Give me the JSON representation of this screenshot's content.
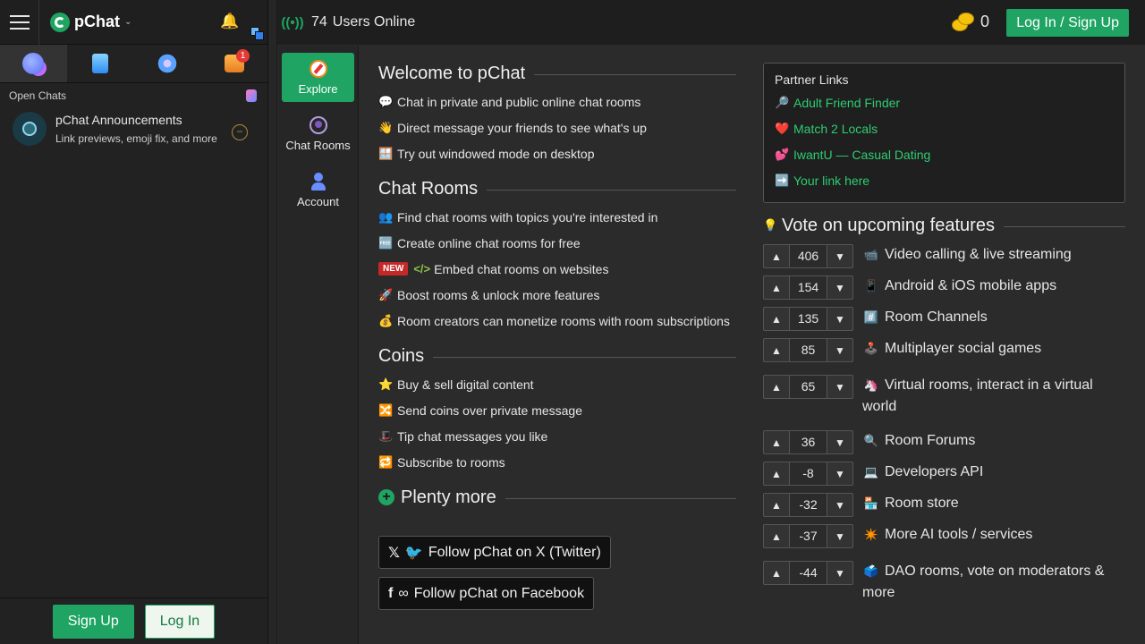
{
  "sidebar": {
    "brand": "pChat",
    "open_chats_label": "Open Chats",
    "tab_badge": "1",
    "chat": {
      "title": "pChat Announcements",
      "subtitle": "Link previews, emoji fix, and more"
    },
    "footer": {
      "signup": "Sign Up",
      "login": "Log In"
    }
  },
  "topbar": {
    "online_count": "74",
    "online_label": "Users Online",
    "coins": "0",
    "login_signup": "Log In / Sign Up"
  },
  "rail": [
    {
      "label": "Explore",
      "icon": "compass-icon"
    },
    {
      "label": "Chat Rooms",
      "icon": "chat-rooms-icon"
    },
    {
      "label": "Account",
      "icon": "account-icon"
    }
  ],
  "welcome": {
    "title": "Welcome to pChat",
    "items": [
      {
        "icon": "💬",
        "text": "Chat in private and public online chat rooms"
      },
      {
        "icon": "👋",
        "text": "Direct message your friends to see what's up"
      },
      {
        "icon": "🪟",
        "text": "Try out windowed mode on desktop"
      }
    ]
  },
  "rooms": {
    "title": "Chat Rooms",
    "items": [
      {
        "icon": "👥",
        "text": "Find chat rooms with topics you're interested in"
      },
      {
        "icon": "🆓",
        "text": "Create online chat rooms for free"
      },
      {
        "badge": "NEW",
        "icon": "</>",
        "text": "Embed chat rooms on websites"
      },
      {
        "icon": "🚀",
        "text": "Boost rooms & unlock more features"
      },
      {
        "icon": "💰",
        "text": "Room creators can monetize rooms with room subscriptions"
      }
    ]
  },
  "coins_section": {
    "title": "Coins",
    "items": [
      {
        "icon": "⭐",
        "text": "Buy & sell digital content"
      },
      {
        "icon": "🔀",
        "text": "Send coins over private message"
      },
      {
        "icon": "🎩",
        "text": "Tip chat messages you like"
      },
      {
        "icon": "🔁",
        "text": "Subscribe to rooms"
      }
    ]
  },
  "plenty": {
    "title": "Plenty more",
    "twitter": "Follow pChat on X (Twitter)",
    "facebook": "Follow pChat on Facebook"
  },
  "partner": {
    "title": "Partner Links",
    "links": [
      {
        "icon": "🔎",
        "text": "Adult Friend Finder"
      },
      {
        "icon": "❤️",
        "text": "Match 2 Locals"
      },
      {
        "icon": "💕",
        "text": "IwantU — Casual Dating"
      },
      {
        "icon": "➡️",
        "text": "Your link here"
      }
    ]
  },
  "votes": {
    "title": "Vote on upcoming features",
    "title_icon": "💡",
    "items": [
      {
        "value": "406",
        "icon": "📹",
        "label": "Video calling & live streaming"
      },
      {
        "value": "154",
        "icon": "📱",
        "label": "Android & iOS mobile apps"
      },
      {
        "value": "135",
        "icon": "#️⃣",
        "label": "Room Channels"
      },
      {
        "value": "85",
        "icon": "🕹️",
        "label": "Multiplayer social games"
      },
      {
        "value": "65",
        "icon": "🦄",
        "label": "Virtual rooms, interact in a virtual world"
      },
      {
        "value": "36",
        "icon": "🔍",
        "label": "Room Forums"
      },
      {
        "value": "-8",
        "icon": "💻",
        "label": "Developers API"
      },
      {
        "value": "-32",
        "icon": "🏪",
        "label": "Room store"
      },
      {
        "value": "-37",
        "icon": "✴️",
        "label": "More AI tools / services"
      },
      {
        "value": "-44",
        "icon": "🗳️",
        "label": "DAO rooms, vote on moderators & more"
      }
    ]
  },
  "colors": {
    "accent": "#1fa463",
    "link": "#2ecc71",
    "badge_new": "#c62828"
  }
}
